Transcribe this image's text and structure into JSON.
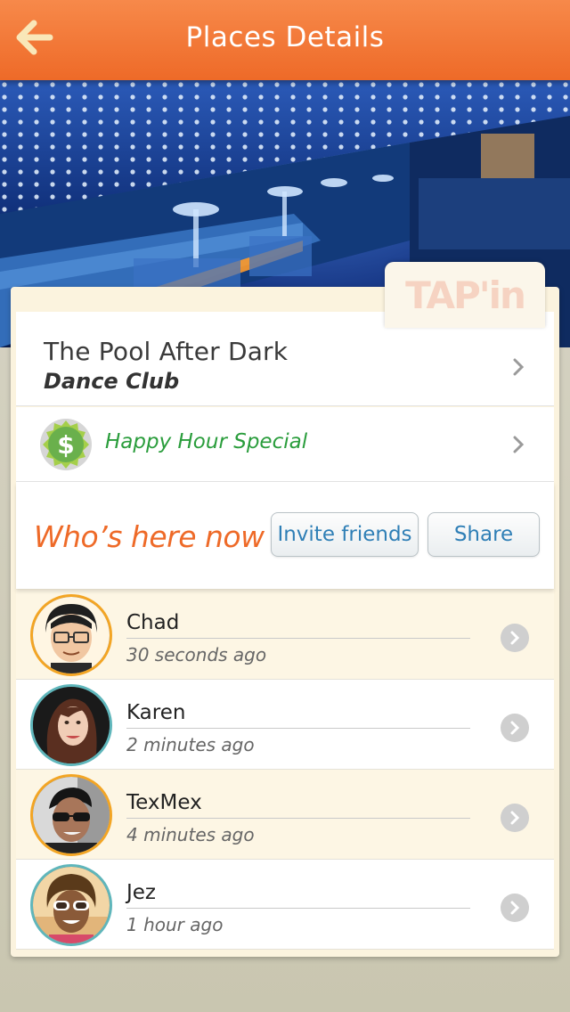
{
  "header": {
    "title": "Places Details",
    "back_icon": "arrow-left-icon",
    "color": "#ee6a28"
  },
  "hero": {
    "image": "night-club-photo"
  },
  "logo": {
    "text": "TAP'in"
  },
  "place": {
    "name": "The Pool After Dark",
    "type": "Dance Club"
  },
  "special": {
    "label": "Happy Hour Special",
    "icon": "dollar-badge-icon",
    "color": "#2a9d3c"
  },
  "who": {
    "title": "Who’s here now",
    "invite_label": "Invite friends",
    "share_label": "Share"
  },
  "friends": [
    {
      "name": "Chad",
      "time": "30 seconds ago"
    },
    {
      "name": "Karen",
      "time": "2 minutes ago"
    },
    {
      "name": "TexMex",
      "time": "4 minutes ago"
    },
    {
      "name": "Jez",
      "time": "1 hour ago"
    }
  ]
}
